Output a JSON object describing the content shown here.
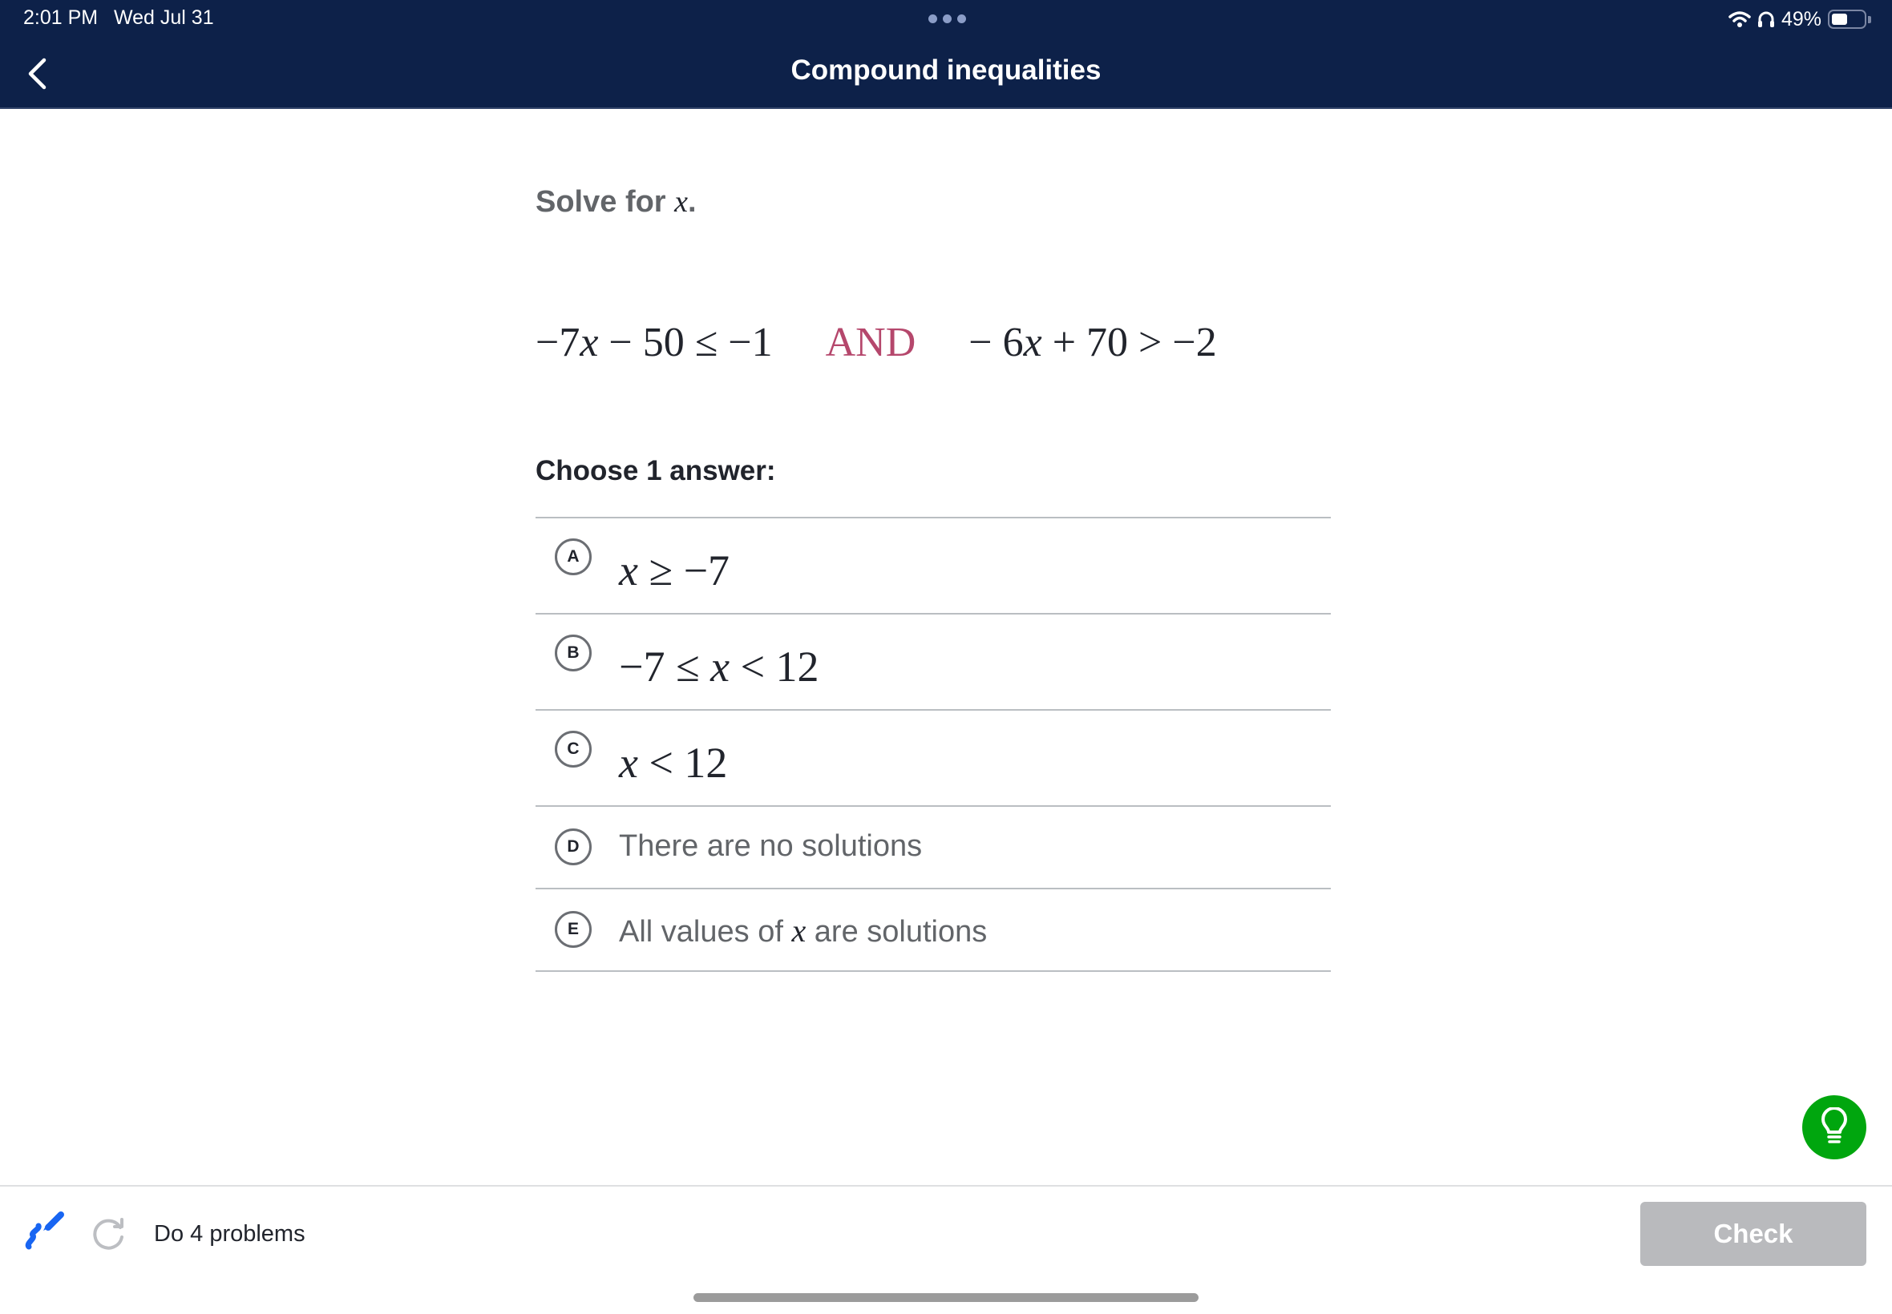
{
  "status_bar": {
    "time": "2:01 PM",
    "date": "Wed Jul 31",
    "battery_percent_label": "49%",
    "battery_level": 0.49,
    "icons": [
      "wifi-icon",
      "headphones-icon",
      "battery-icon"
    ]
  },
  "nav": {
    "title": "Compound inequalities",
    "back_icon": "chevron-left-icon",
    "more_icon": "ellipsis-icon"
  },
  "question": {
    "prompt_text": "Solve for ",
    "prompt_var": "x",
    "prompt_end": ".",
    "equation_left": "−7x − 50 ≤ −1",
    "equation_left_parts": [
      "−7",
      "x",
      " − 50 ≤ −1"
    ],
    "connector": "AND",
    "equation_right_parts": [
      "− 6",
      "x",
      " + 70 > −2"
    ],
    "choose_label": "Choose 1 answer:"
  },
  "choices": [
    {
      "letter": "A",
      "parts": [
        "",
        "x",
        " ≥ −7"
      ],
      "type": "math"
    },
    {
      "letter": "B",
      "parts": [
        "−7 ≤ ",
        "x",
        " < 12"
      ],
      "type": "math"
    },
    {
      "letter": "C",
      "parts": [
        "",
        "x",
        " < 12"
      ],
      "type": "math"
    },
    {
      "letter": "D",
      "text": "There are no solutions",
      "type": "text"
    },
    {
      "letter": "E",
      "text_before": "All values of ",
      "var": "x",
      "text_after": " are solutions",
      "type": "text"
    }
  ],
  "footer": {
    "progress_label": "Do 4 problems",
    "check_label": "Check",
    "check_enabled": false,
    "scratchpad_icon": "scratchpad-pencil-icon",
    "retry_icon": "refresh-icon",
    "hint_icon": "lightbulb-icon"
  },
  "colors": {
    "nav_bg": "#0d2149",
    "and_color": "#b5476c",
    "hint_green": "#00a60e",
    "scratch_blue": "#1865f2",
    "check_disabled": "#b9babd"
  }
}
